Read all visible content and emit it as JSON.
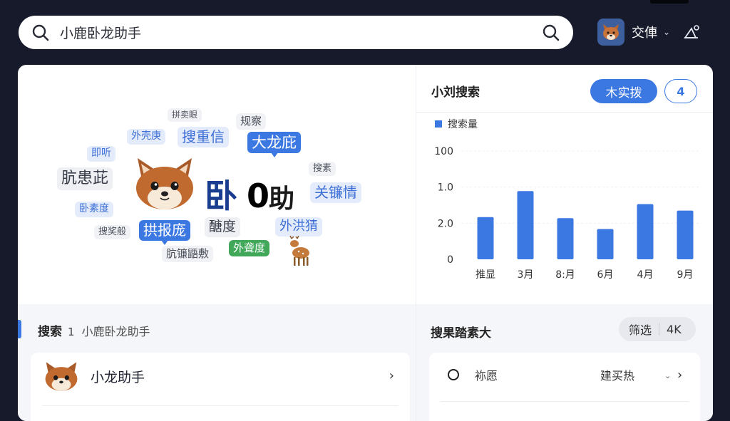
{
  "search": {
    "value": "小鹿卧龙助手"
  },
  "user": {
    "name": "交俥"
  },
  "cloud": {
    "center": {
      "main": "卧",
      "mid": "0",
      "end": "助"
    },
    "tags": [
      {
        "text": "拼卖眼",
        "style": "tag-lgray",
        "pos": "t1"
      },
      {
        "text": "规察",
        "style": "tag-lgray",
        "pos": "t2"
      },
      {
        "text": "外壳庚",
        "style": "tag-lblue",
        "pos": "t3"
      },
      {
        "text": "搜重信",
        "style": "tag-lblue",
        "pos": "t4"
      },
      {
        "text": "大龙庇",
        "style": "tag-blue",
        "pos": "t5"
      },
      {
        "text": "即听",
        "style": "tag-lblue",
        "pos": "t6"
      },
      {
        "text": "肮患茈",
        "style": "tag-gray",
        "pos": "t7"
      },
      {
        "text": "搜素",
        "style": "tag-lgray",
        "pos": "t8"
      },
      {
        "text": "关镰情",
        "style": "tag-lblue",
        "pos": "t9"
      },
      {
        "text": "卧素度",
        "style": "tag-lblue",
        "pos": "t10"
      },
      {
        "text": "搜奖般",
        "style": "tag-lgray",
        "pos": "t11"
      },
      {
        "text": "拱报庞",
        "style": "tag-blue",
        "pos": "t12"
      },
      {
        "text": "醣度",
        "style": "tag-gray",
        "pos": "t13"
      },
      {
        "text": "外洪猜",
        "style": "tag-lblue",
        "pos": "t14"
      },
      {
        "text": "外聋度",
        "style": "tag-green",
        "pos": "t15"
      },
      {
        "text": "肮镰鼯敷",
        "style": "tag-lgray",
        "pos": "t16"
      }
    ]
  },
  "trend": {
    "title": "小刘搜索",
    "primary_pill": "木实拨",
    "count_pill": "4"
  },
  "chart_data": {
    "type": "bar",
    "series": [
      {
        "name": "搜索量",
        "values": [
          39,
          63,
          38,
          28,
          51,
          45
        ]
      }
    ],
    "categories": [
      "推显",
      "3月",
      "8:月",
      "6月",
      "4月",
      "9月"
    ],
    "ytick_labels": [
      "0",
      "2.0",
      "1.0",
      "100"
    ],
    "ylim": [
      0,
      100
    ],
    "grid": true,
    "legend": "top-left",
    "color": "#3c78e2"
  },
  "results": {
    "title": "搜索",
    "count": "1",
    "query": "小鹿卧龙助手",
    "items": [
      {
        "label": "小龙助手"
      }
    ]
  },
  "tracking": {
    "title": "搜果踏素大",
    "filter_label": "筛选",
    "filter_value": "4K",
    "row": {
      "label": "袮愿",
      "value": "建买热"
    }
  }
}
